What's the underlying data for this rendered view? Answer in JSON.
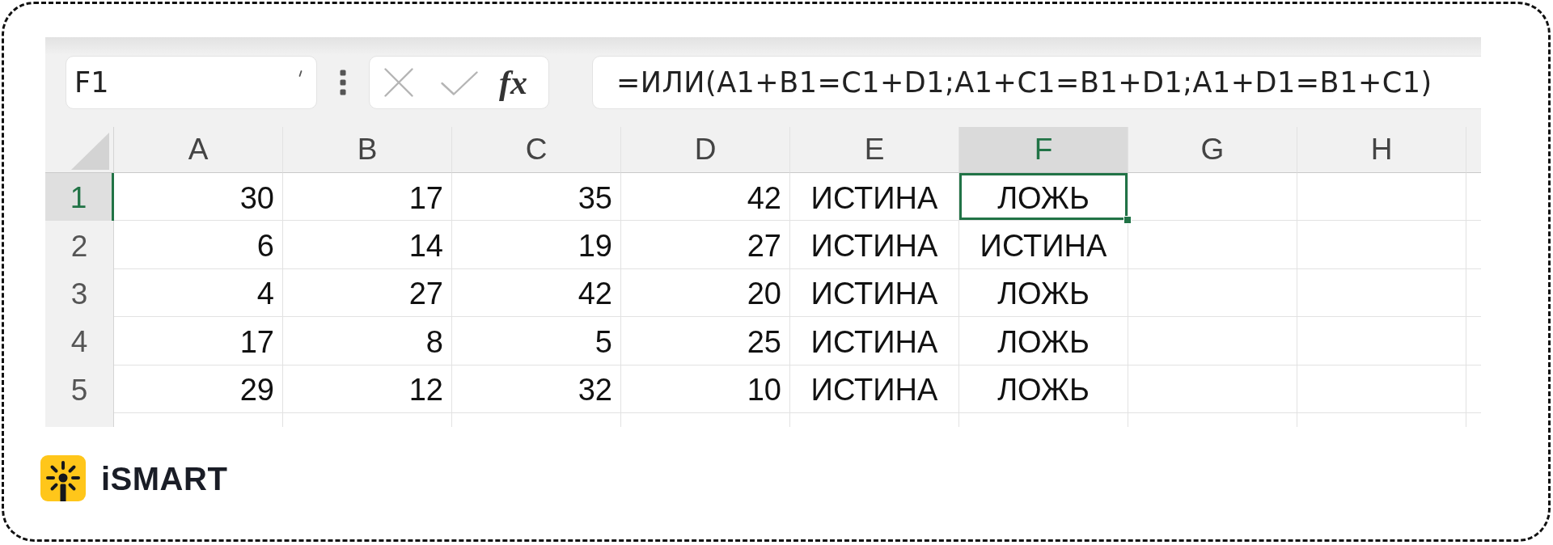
{
  "name_box": {
    "value": "F1"
  },
  "formula_buttons": [
    {
      "kind": "cancel",
      "disabled": true
    },
    {
      "kind": "enter",
      "disabled": true
    },
    {
      "kind": "function",
      "label": "fx",
      "disabled": false
    }
  ],
  "formula_bar": {
    "value": "=ИЛИ(A1+B1=C1+D1;A1+C1=B1+D1;A1+D1=B1+C1)"
  },
  "sheet": {
    "columns": [
      {
        "label": "A",
        "selected": false
      },
      {
        "label": "B",
        "selected": false
      },
      {
        "label": "C",
        "selected": false
      },
      {
        "label": "D",
        "selected": false
      },
      {
        "label": "E",
        "selected": false
      },
      {
        "label": "F",
        "selected": true
      },
      {
        "label": "G",
        "selected": false
      },
      {
        "label": "H",
        "selected": false
      }
    ],
    "rows": [
      {
        "label": "1",
        "selected": true,
        "cells": [
          {
            "value": "30",
            "kind": "number",
            "selected": false
          },
          {
            "value": "17",
            "kind": "number",
            "selected": false
          },
          {
            "value": "35",
            "kind": "number",
            "selected": false
          },
          {
            "value": "42",
            "kind": "number",
            "selected": false
          },
          {
            "value": "ИСТИНА",
            "kind": "boolean",
            "selected": false
          },
          {
            "value": "ЛОЖЬ",
            "kind": "boolean",
            "selected": true
          },
          {
            "selected": false
          },
          {
            "selected": false
          }
        ]
      },
      {
        "label": "2",
        "selected": false,
        "cells": [
          {
            "value": "6",
            "kind": "number",
            "selected": false
          },
          {
            "value": "14",
            "kind": "number",
            "selected": false
          },
          {
            "value": "19",
            "kind": "number",
            "selected": false
          },
          {
            "value": "27",
            "kind": "number",
            "selected": false
          },
          {
            "value": "ИСТИНА",
            "kind": "boolean",
            "selected": false
          },
          {
            "value": "ИСТИНА",
            "kind": "boolean",
            "selected": false
          },
          {
            "selected": false
          },
          {
            "selected": false
          }
        ]
      },
      {
        "label": "3",
        "selected": false,
        "cells": [
          {
            "value": "4",
            "kind": "number",
            "selected": false
          },
          {
            "value": "27",
            "kind": "number",
            "selected": false
          },
          {
            "value": "42",
            "kind": "number",
            "selected": false
          },
          {
            "value": "20",
            "kind": "number",
            "selected": false
          },
          {
            "value": "ИСТИНА",
            "kind": "boolean",
            "selected": false
          },
          {
            "value": "ЛОЖЬ",
            "kind": "boolean",
            "selected": false
          },
          {
            "selected": false
          },
          {
            "selected": false
          }
        ]
      },
      {
        "label": "4",
        "selected": false,
        "cells": [
          {
            "value": "17",
            "kind": "number",
            "selected": false
          },
          {
            "value": "8",
            "kind": "number",
            "selected": false
          },
          {
            "value": "5",
            "kind": "number",
            "selected": false
          },
          {
            "value": "25",
            "kind": "number",
            "selected": false
          },
          {
            "value": "ИСТИНА",
            "kind": "boolean",
            "selected": false
          },
          {
            "value": "ЛОЖЬ",
            "kind": "boolean",
            "selected": false
          },
          {
            "selected": false
          },
          {
            "selected": false
          }
        ]
      },
      {
        "label": "5",
        "selected": false,
        "cells": [
          {
            "value": "29",
            "kind": "number",
            "selected": false
          },
          {
            "value": "12",
            "kind": "number",
            "selected": false
          },
          {
            "value": "32",
            "kind": "number",
            "selected": false
          },
          {
            "value": "10",
            "kind": "number",
            "selected": false
          },
          {
            "value": "ИСТИНА",
            "kind": "boolean",
            "selected": false
          },
          {
            "value": "ЛОЖЬ",
            "kind": "boolean",
            "selected": false
          },
          {
            "selected": false
          },
          {
            "selected": false
          }
        ]
      }
    ]
  },
  "brand": {
    "name": "iSMART"
  }
}
